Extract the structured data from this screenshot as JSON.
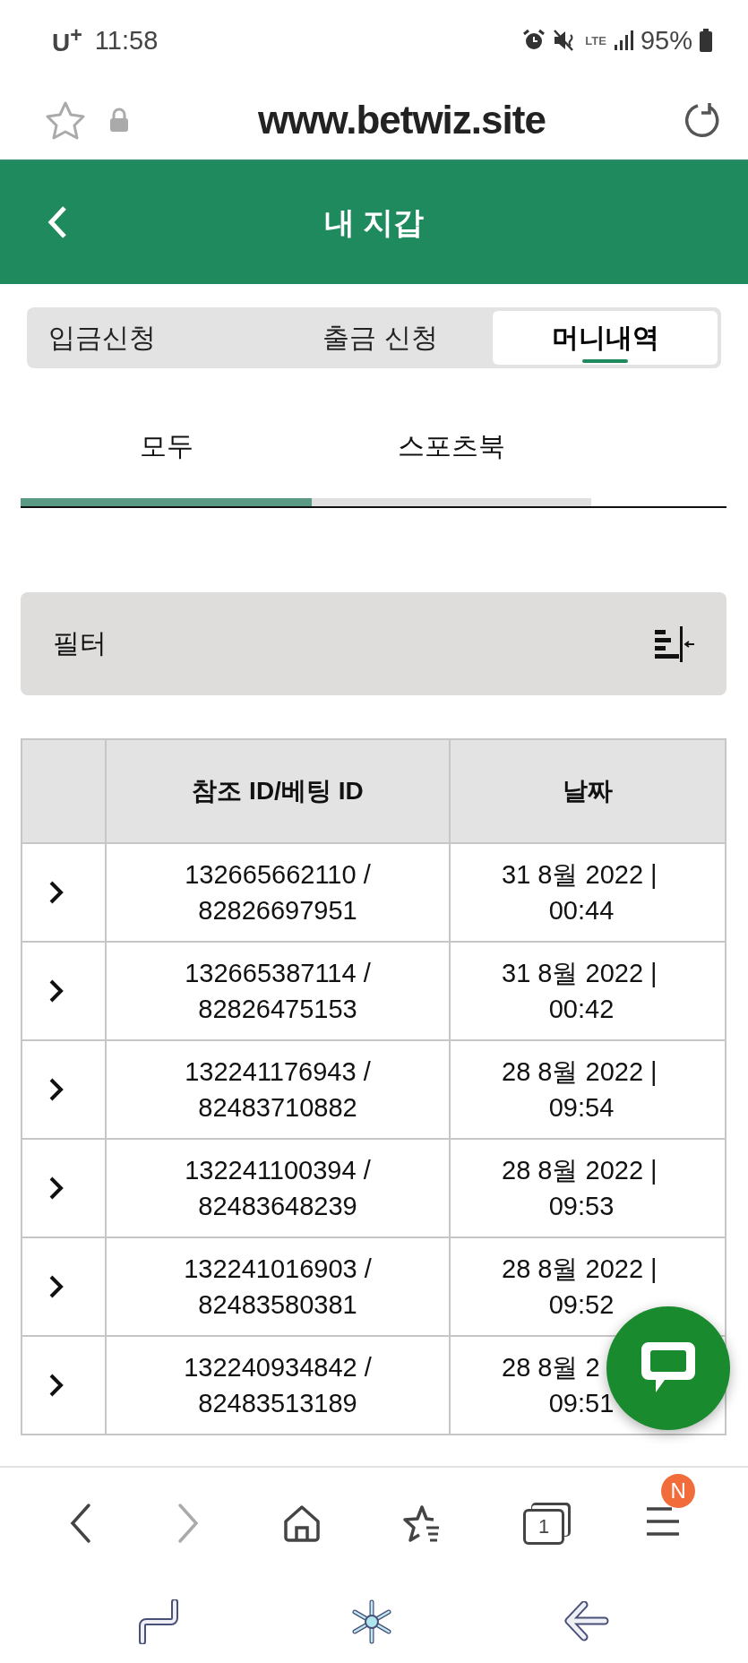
{
  "status_bar": {
    "carrier": "U$^{+}$",
    "time": "11:58",
    "network": "LTE",
    "battery": "95%"
  },
  "browser": {
    "url": "www.betwiz.site"
  },
  "header": {
    "title": "내 지갑"
  },
  "tabs": [
    {
      "label": "입금신청",
      "selected": false
    },
    {
      "label": "출금 신청",
      "selected": false
    },
    {
      "label": "머니내역",
      "selected": true
    }
  ],
  "sub_tabs": [
    {
      "label": "모두",
      "selected": true
    },
    {
      "label": "스포츠북",
      "selected": false
    }
  ],
  "filter": {
    "label": "필터"
  },
  "table": {
    "columns": [
      "참조 ID/베팅 ID",
      "날짜"
    ],
    "rows": [
      {
        "ref": "132665662110 /",
        "bet": "82826697951",
        "date": "31 8월 2022 |",
        "time": "00:44"
      },
      {
        "ref": "132665387114 /",
        "bet": "82826475153",
        "date": "31 8월 2022 |",
        "time": "00:42"
      },
      {
        "ref": "132241176943 /",
        "bet": "82483710882",
        "date": "28 8월 2022 |",
        "time": "09:54"
      },
      {
        "ref": "132241100394 /",
        "bet": "82483648239",
        "date": "28 8월 2022 |",
        "time": "09:53"
      },
      {
        "ref": "132241016903 /",
        "bet": "82483580381",
        "date": "28 8월 2022 |",
        "time": "09:52"
      },
      {
        "ref": "132240934842 /",
        "bet": "82483513189",
        "date": "28 8월 2",
        "time": "09:51"
      }
    ]
  },
  "bottom_nav": {
    "forward_disabled": true,
    "tab_count": "1",
    "badge": "N"
  }
}
